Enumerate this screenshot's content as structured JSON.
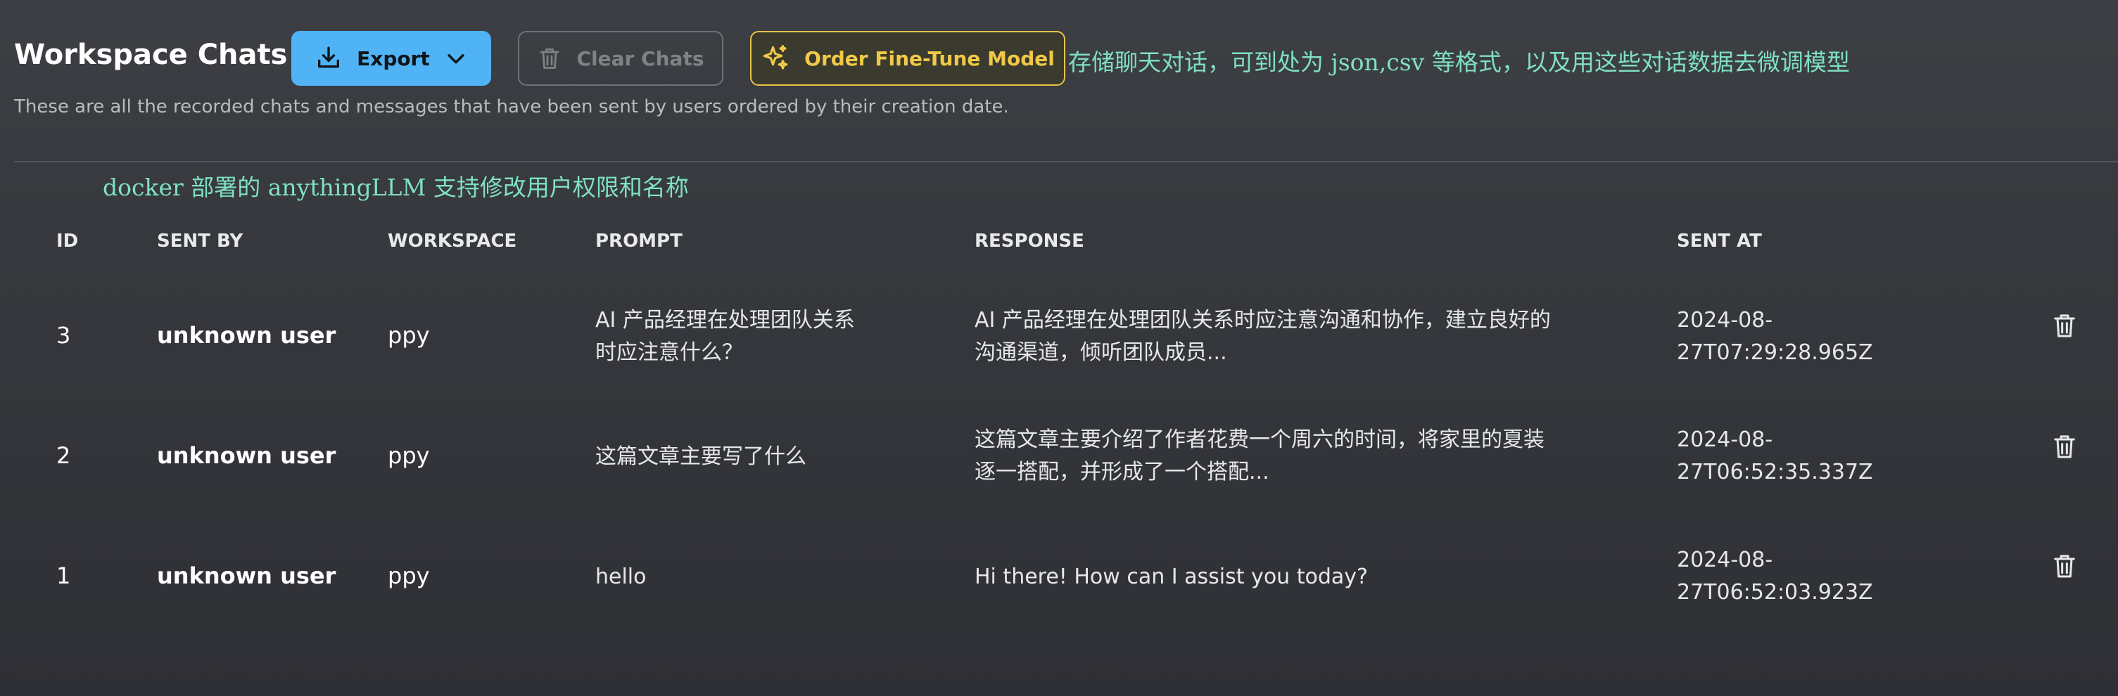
{
  "header": {
    "title": "Workspace Chats",
    "subtitle": "These are all the recorded chats and messages that have been sent by users ordered by their creation date."
  },
  "toolbar": {
    "export_label": "Export",
    "clear_label": "Clear Chats",
    "order_label": "Order Fine-Tune Model"
  },
  "annotations": {
    "top": "存储聊天对话，可到处为 json,csv 等格式，以及用这些对话数据去微调模型",
    "mid": "docker 部署的 anythingLLM 支持修改用户权限和名称"
  },
  "table": {
    "columns": [
      "ID",
      "SENT BY",
      "WORKSPACE",
      "PROMPT",
      "RESPONSE",
      "SENT AT"
    ],
    "rows": [
      {
        "id": "3",
        "sent_by": "unknown user",
        "workspace": "ppy",
        "prompt": [
          "AI 产品经理在处理团队关系",
          "时应注意什么？"
        ],
        "response": [
          "AI 产品经理在处理团队关系时应注意沟通和协作，建立良好的",
          "沟通渠道，倾听团队成员..."
        ],
        "sent_at": [
          "2024-08-",
          "27T07:29:28.965Z"
        ]
      },
      {
        "id": "2",
        "sent_by": "unknown user",
        "workspace": "ppy",
        "prompt": [
          "这篇文章主要写了什么"
        ],
        "response": [
          "这篇文章主要介绍了作者花费一个周六的时间，将家里的夏装",
          "逐一搭配，并形成了一个搭配..."
        ],
        "sent_at": [
          "2024-08-",
          "27T06:52:35.337Z"
        ]
      },
      {
        "id": "1",
        "sent_by": "unknown user",
        "workspace": "ppy",
        "prompt": [
          "hello"
        ],
        "response": [
          "Hi there! How can I assist you today?"
        ],
        "sent_at": [
          "2024-08-",
          "27T06:52:03.923Z"
        ]
      }
    ]
  },
  "icons": {
    "export": "download-icon",
    "export_menu": "chevron-down-icon",
    "clear": "trash-icon",
    "order": "sparkles-icon",
    "row_delete": "trash-icon"
  },
  "colors": {
    "export_bg": "#4fb3f6",
    "order_border": "#e8c44a",
    "annotation": "#7fe0c2"
  }
}
